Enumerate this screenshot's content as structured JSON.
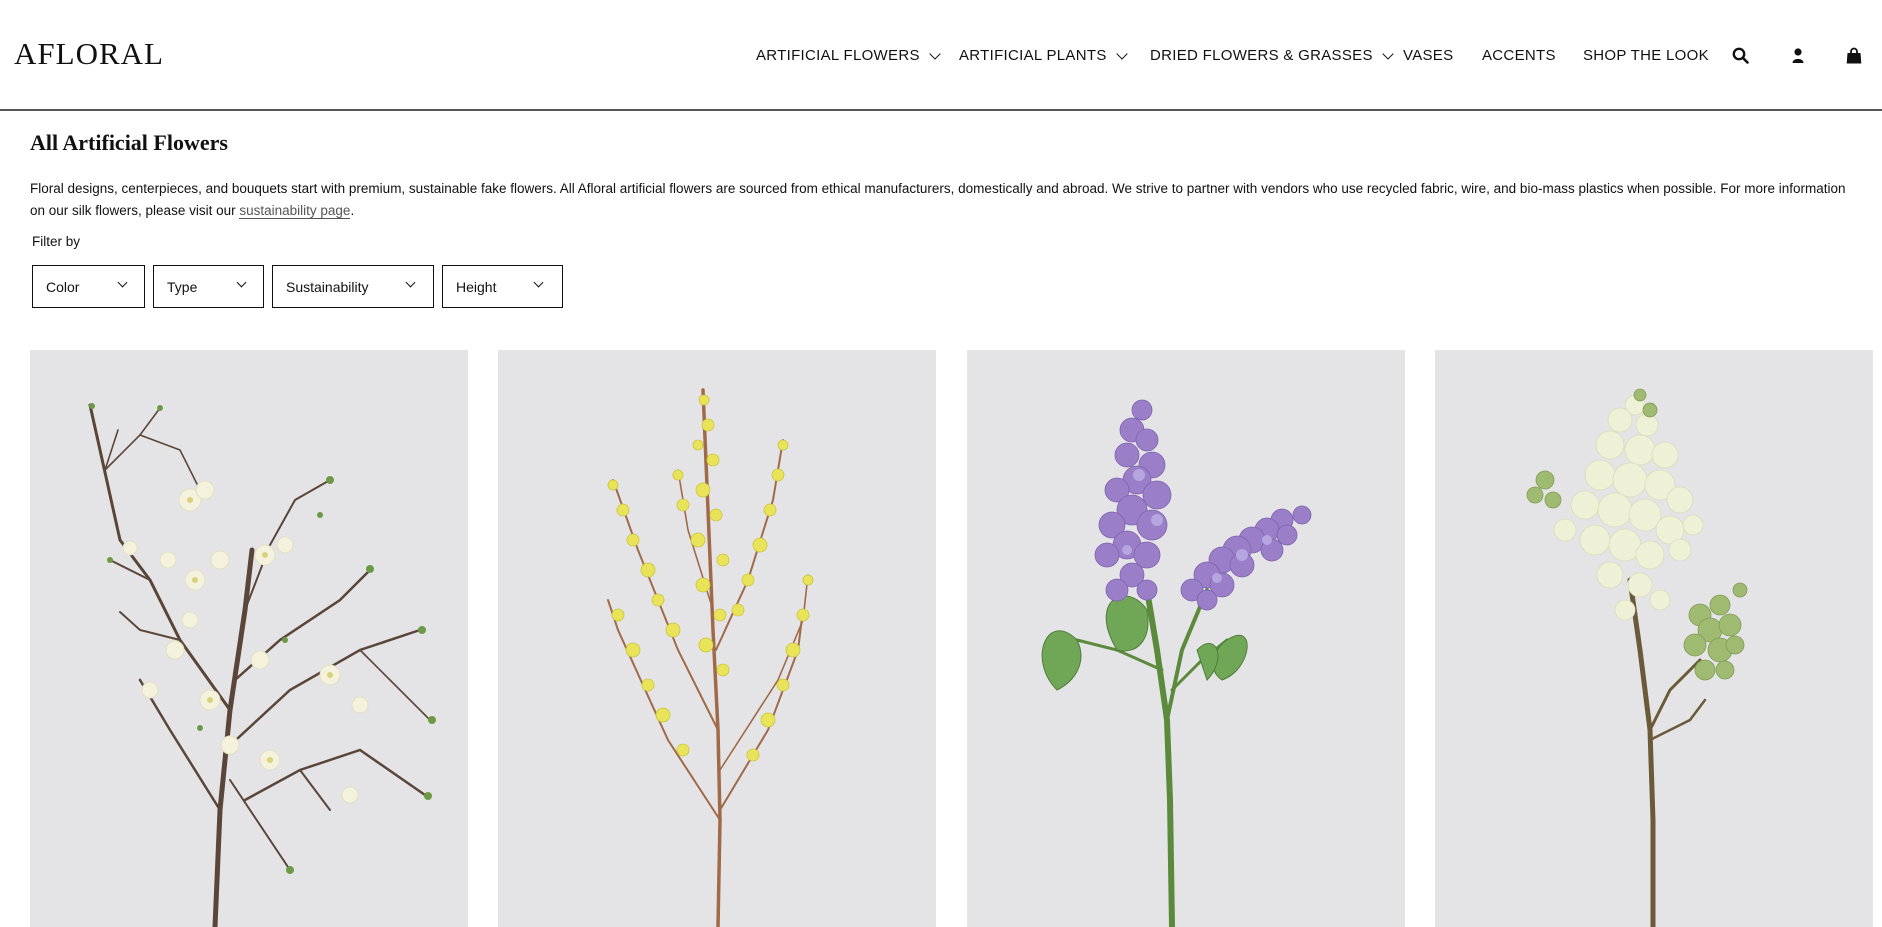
{
  "header": {
    "logo": "AFLORAL",
    "nav": [
      {
        "label": "ARTIFICIAL FLOWERS",
        "dropdown": true
      },
      {
        "label": "ARTIFICIAL PLANTS",
        "dropdown": true
      },
      {
        "label": "DRIED FLOWERS & GRASSES",
        "dropdown": true
      },
      {
        "label": "VASES",
        "dropdown": false
      },
      {
        "label": "ACCENTS",
        "dropdown": false
      },
      {
        "label": "SHOP THE LOOK",
        "dropdown": false
      }
    ],
    "icons": [
      "search-icon",
      "account-icon",
      "cart-icon"
    ]
  },
  "page": {
    "title": "All Artificial Flowers",
    "description": "Floral designs, centerpieces, and bouquets start with premium, sustainable fake flowers. All Afloral artificial flowers are sourced from ethical manufacturers, domestically and abroad. We strive to partner with vendors who use recycled fabric, wire, and bio-mass plastics when possible. For more information on our silk flowers, please visit our",
    "description_link": "sustainability page",
    "description_end": "."
  },
  "filters": {
    "label": "Filter by",
    "items": [
      "Color",
      "Type",
      "Sustainability",
      "Height"
    ]
  },
  "products": [
    {
      "image": "white-blossom-branch-image",
      "flower_color": "#f4f2dc"
    },
    {
      "image": "yellow-forsythia-branch-image",
      "flower_color": "#e9e35a"
    },
    {
      "image": "purple-lilac-stem-image",
      "flower_color": "#9a7fc8"
    },
    {
      "image": "cream-lilac-stem-image",
      "flower_color": "#eef1d6"
    }
  ],
  "colors": {
    "text": "#111111",
    "image_background": "#e4e4e6",
    "header_rule": "#555555"
  }
}
